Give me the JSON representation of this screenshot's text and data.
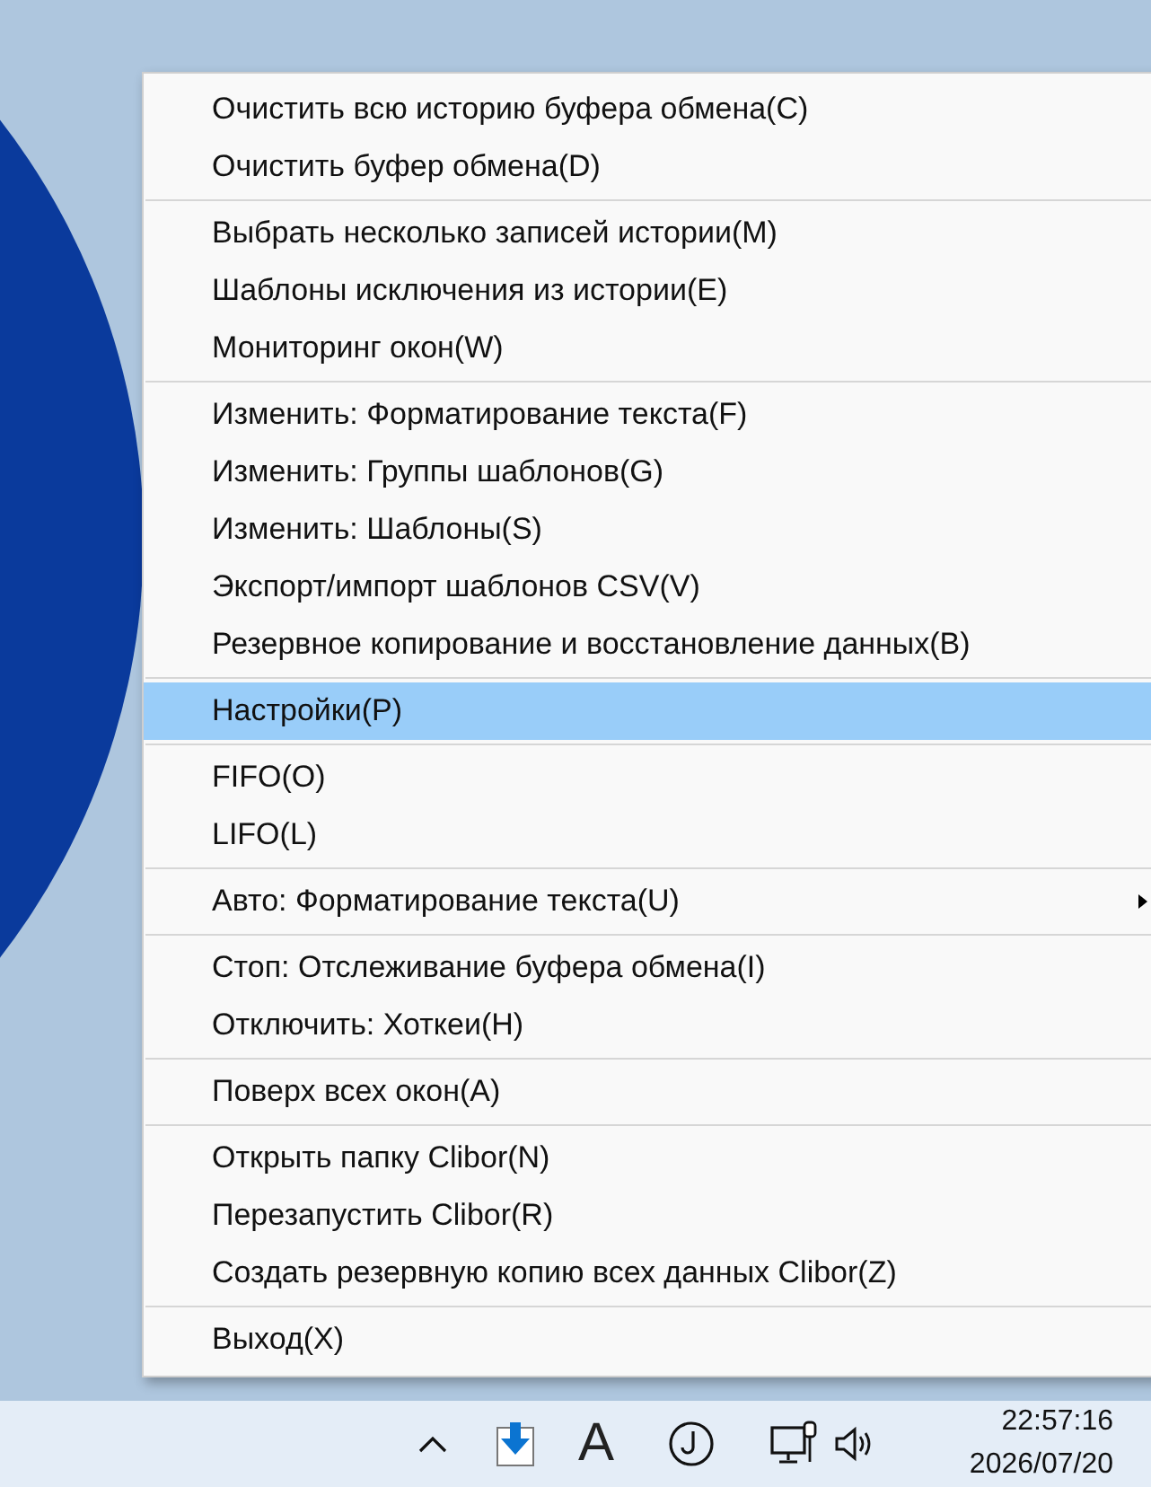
{
  "menu": {
    "sections": [
      {
        "items": [
          {
            "label": "Очистить всю историю буфера обмена(C)",
            "selected": false,
            "submenu": false
          },
          {
            "label": "Очистить буфер обмена(D)",
            "selected": false,
            "submenu": false
          }
        ]
      },
      {
        "items": [
          {
            "label": "Выбрать несколько записей истории(M)",
            "selected": false,
            "submenu": false
          },
          {
            "label": "Шаблоны исключения из истории(E)",
            "selected": false,
            "submenu": false
          },
          {
            "label": "Мониторинг окон(W)",
            "selected": false,
            "submenu": false
          }
        ]
      },
      {
        "items": [
          {
            "label": "Изменить: Форматирование текста(F)",
            "selected": false,
            "submenu": false
          },
          {
            "label": "Изменить: Группы шаблонов(G)",
            "selected": false,
            "submenu": false
          },
          {
            "label": "Изменить: Шаблоны(S)",
            "selected": false,
            "submenu": false
          },
          {
            "label": "Экспорт/импорт шаблонов CSV(V)",
            "selected": false,
            "submenu": false
          },
          {
            "label": "Резервное копирование и восстановление данных(B)",
            "selected": false,
            "submenu": false
          }
        ]
      },
      {
        "items": [
          {
            "label": "Настройки(P)",
            "selected": true,
            "submenu": false
          }
        ]
      },
      {
        "items": [
          {
            "label": "FIFO(O)",
            "selected": false,
            "submenu": false
          },
          {
            "label": "LIFO(L)",
            "selected": false,
            "submenu": false
          }
        ]
      },
      {
        "items": [
          {
            "label": "Авто: Форматирование текста(U)",
            "selected": false,
            "submenu": true
          }
        ]
      },
      {
        "items": [
          {
            "label": "Стоп: Отслеживание буфера обмена(I)",
            "selected": false,
            "submenu": false
          },
          {
            "label": "Отключить: Хоткеи(H)",
            "selected": false,
            "submenu": false
          }
        ]
      },
      {
        "items": [
          {
            "label": "Поверх всех окон(A)",
            "selected": false,
            "submenu": false
          }
        ]
      },
      {
        "items": [
          {
            "label": "Открыть папку Clibor(N)",
            "selected": false,
            "submenu": false
          },
          {
            "label": "Перезапустить Clibor(R)",
            "selected": false,
            "submenu": false
          },
          {
            "label": "Создать резервную копию всех данных Clibor(Z)",
            "selected": false,
            "submenu": false
          }
        ]
      },
      {
        "items": [
          {
            "label": "Выход(X)",
            "selected": false,
            "submenu": false
          }
        ]
      }
    ]
  },
  "taskbar": {
    "input_indicator": "A",
    "time": "22:57:16",
    "date": "2026/07/20"
  }
}
